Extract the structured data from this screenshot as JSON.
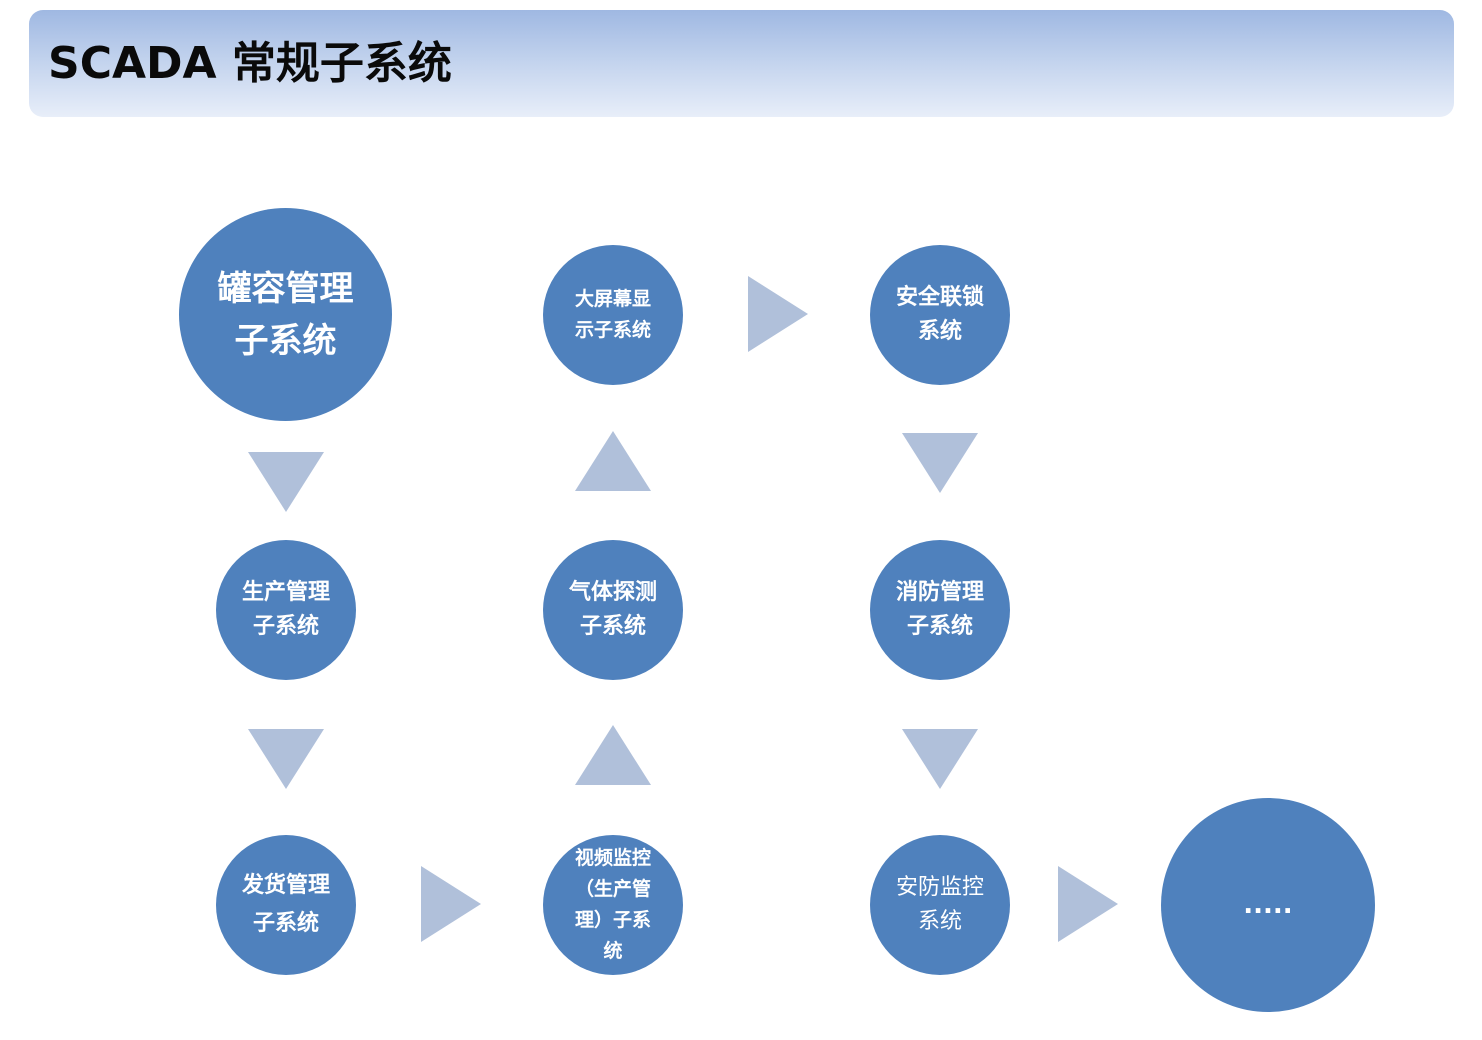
{
  "header": {
    "title": "SCADA 常规子系统"
  },
  "nodes": {
    "tank": "罐容管理子系统",
    "production": "生产管理子系统",
    "shipping": "发货管理子系统",
    "video": "视频监控（生产管理）子系统",
    "gas": "气体探测子系统",
    "big_screen": "大屏幕显示子系统",
    "safety_interlock": "安全联锁系统",
    "fire": "消防管理子系统",
    "security": "安防监控系统",
    "more": "....."
  },
  "colors": {
    "node_fill": "#4f81bd",
    "arrow_fill": "#b0c0da",
    "header_gradient_top": "#9fb8e2",
    "header_gradient_bottom": "#e8eef9"
  }
}
